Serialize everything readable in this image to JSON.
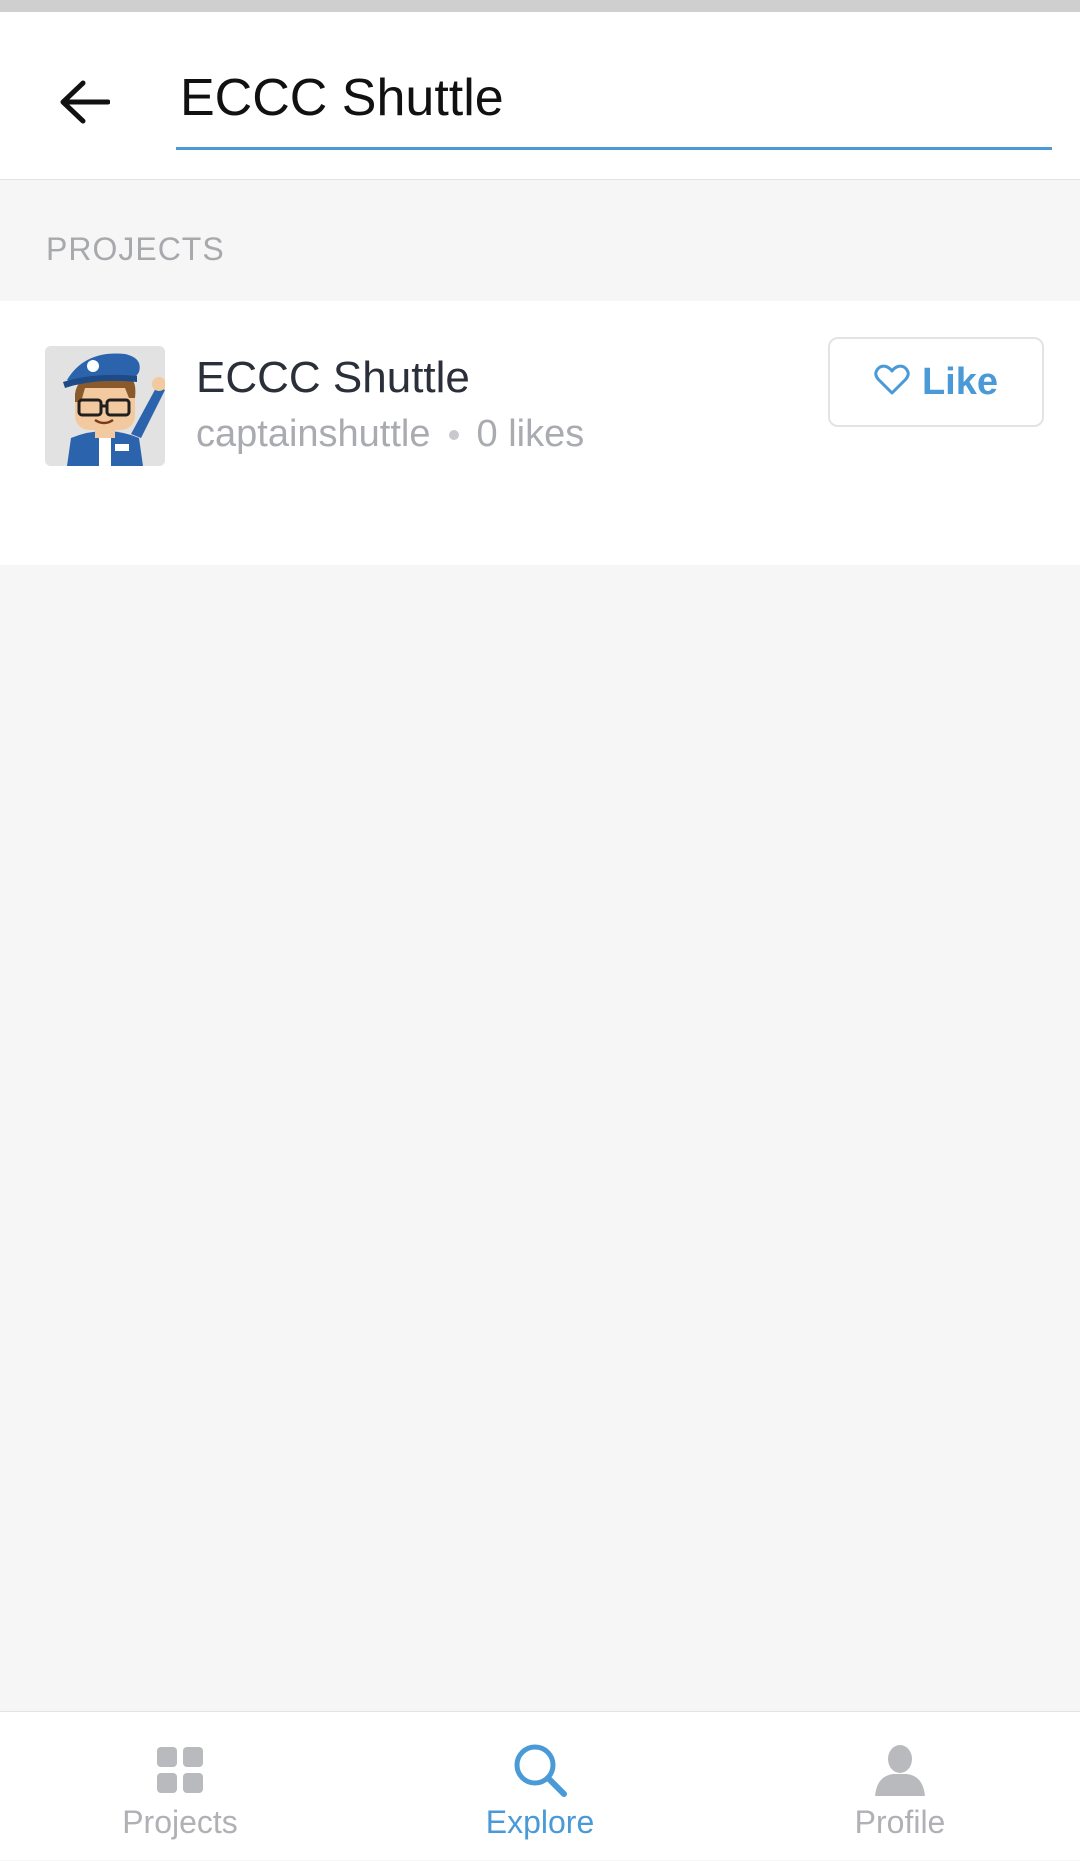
{
  "search": {
    "value": "ECCC Shuttle",
    "placeholder": ""
  },
  "section": {
    "title": "PROJECTS"
  },
  "results": [
    {
      "title": "ECCC Shuttle",
      "author": "captainshuttle",
      "likes": "0 likes",
      "like_label": "Like",
      "avatar_icon": "captain-mascot"
    }
  ],
  "bottom_nav": {
    "items": [
      {
        "label": "Projects",
        "icon": "grid-icon",
        "active": false
      },
      {
        "label": "Explore",
        "icon": "search-icon",
        "active": true
      },
      {
        "label": "Profile",
        "icon": "person-icon",
        "active": false
      }
    ]
  },
  "colors": {
    "accent": "#4a9ad8",
    "muted_text": "#a9abb0",
    "background": "#f6f6f6"
  }
}
